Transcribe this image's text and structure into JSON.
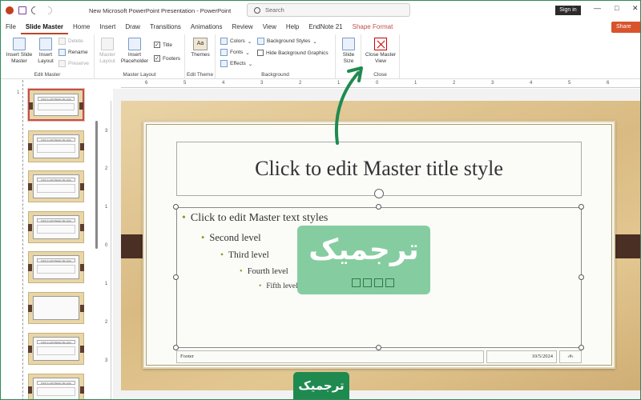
{
  "window": {
    "title": "New Microsoft PowerPoint Presentation  -  PowerPoint",
    "search_placeholder": "Search",
    "sign_in": "Sign in",
    "minimize": "—",
    "maximize": "□",
    "close": "✕"
  },
  "tabs": [
    {
      "label": "File"
    },
    {
      "label": "Slide Master"
    },
    {
      "label": "Home"
    },
    {
      "label": "Insert"
    },
    {
      "label": "Draw"
    },
    {
      "label": "Transitions"
    },
    {
      "label": "Animations"
    },
    {
      "label": "Review"
    },
    {
      "label": "View"
    },
    {
      "label": "Help"
    },
    {
      "label": "EndNote 21"
    },
    {
      "label": "Shape Format"
    }
  ],
  "share_label": "Share",
  "ribbon": {
    "edit_master": {
      "label": "Edit Master",
      "insert_slide_master": "Insert Slide Master",
      "insert_layout": "Insert Layout",
      "delete": "Delete",
      "rename": "Rename",
      "preserve": "Preserve"
    },
    "master_layout": {
      "label": "Master Layout",
      "master_layout": "Master Layout",
      "insert_placeholder": "Insert Placeholder",
      "title": "Title",
      "footers": "Footers"
    },
    "edit_theme": {
      "label": "Edit Theme",
      "themes": "Themes"
    },
    "background": {
      "label": "Background",
      "colors": "Colors",
      "fonts": "Fonts",
      "effects": "Effects",
      "background_styles": "Background Styles",
      "hide_background_graphics": "Hide Background Graphics"
    },
    "size": {
      "slide_size": "Slide Size"
    },
    "close": {
      "label": "Close",
      "close_master_view": "Close Master View"
    }
  },
  "ruler": {
    "horizontal": [
      "6",
      "5",
      "4",
      "3",
      "2",
      "1",
      "0",
      "1",
      "2",
      "3",
      "4",
      "5",
      "6"
    ],
    "vertical": [
      "3",
      "2",
      "1",
      "0",
      "1",
      "2",
      "3"
    ]
  },
  "thumbnails": [
    {
      "num": "1",
      "text": "Click to edit Master title style"
    },
    {
      "num": "",
      "text": "Click to edit Master title style"
    },
    {
      "num": "",
      "text": "Click to edit Master title style"
    },
    {
      "num": "",
      "text": "Click to edit Master title style"
    },
    {
      "num": "",
      "text": "Click to edit Master title style"
    },
    {
      "num": "",
      "text": ""
    },
    {
      "num": "",
      "text": "Click to edit Master title style"
    },
    {
      "num": "",
      "text": "Click to edit Master title style"
    }
  ],
  "slide": {
    "title": "Click to edit Master title style",
    "levels": [
      "Click to edit Master text styles",
      "Second level",
      "Third level",
      "Fourth level",
      "Fifth level"
    ],
    "footer": "Footer",
    "date": "10/5/2024",
    "page_number": "‹#›"
  },
  "watermark": {
    "text": "ترجمیک",
    "badge": "ترجمیک"
  },
  "colors": {
    "accent": "#b7472a",
    "brand_green": "#1f8a4f",
    "arrow": "#1f8a4f"
  }
}
